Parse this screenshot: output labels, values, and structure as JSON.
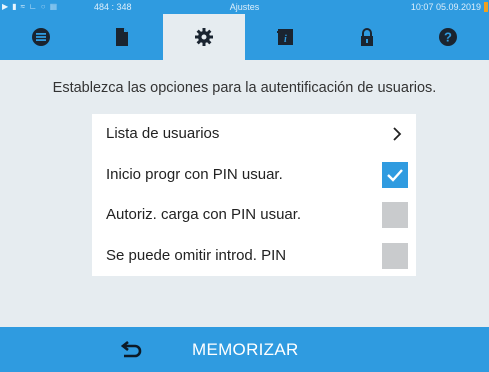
{
  "status_bar": {
    "coords": "484 : 348",
    "title": "Ajustes",
    "datetime": "10:07  05.09.2019"
  },
  "tabs": [
    {
      "name": "list-icon",
      "active": false
    },
    {
      "name": "document-icon",
      "active": false
    },
    {
      "name": "gear-icon",
      "active": true
    },
    {
      "name": "info-book-icon",
      "active": false
    },
    {
      "name": "lock-icon",
      "active": false
    },
    {
      "name": "help-icon",
      "active": false
    }
  ],
  "main": {
    "description": "Establezca las opciones para la autentificación de usuarios.",
    "options": [
      {
        "label": "Lista de usuarios",
        "control": "chevron"
      },
      {
        "label": "Inicio progr con PIN usuar.",
        "control": "checkbox",
        "checked": true
      },
      {
        "label": "Autoriz. carga con PIN usuar.",
        "control": "checkbox",
        "checked": false
      },
      {
        "label": "Se puede omitir introd. PIN",
        "control": "checkbox",
        "checked": false
      }
    ]
  },
  "bottom_bar": {
    "save_label": "MEMORIZAR"
  },
  "colors": {
    "accent": "#2f9be0",
    "background": "#e6ecf0",
    "checkbox_off": "#c9cbcd"
  }
}
